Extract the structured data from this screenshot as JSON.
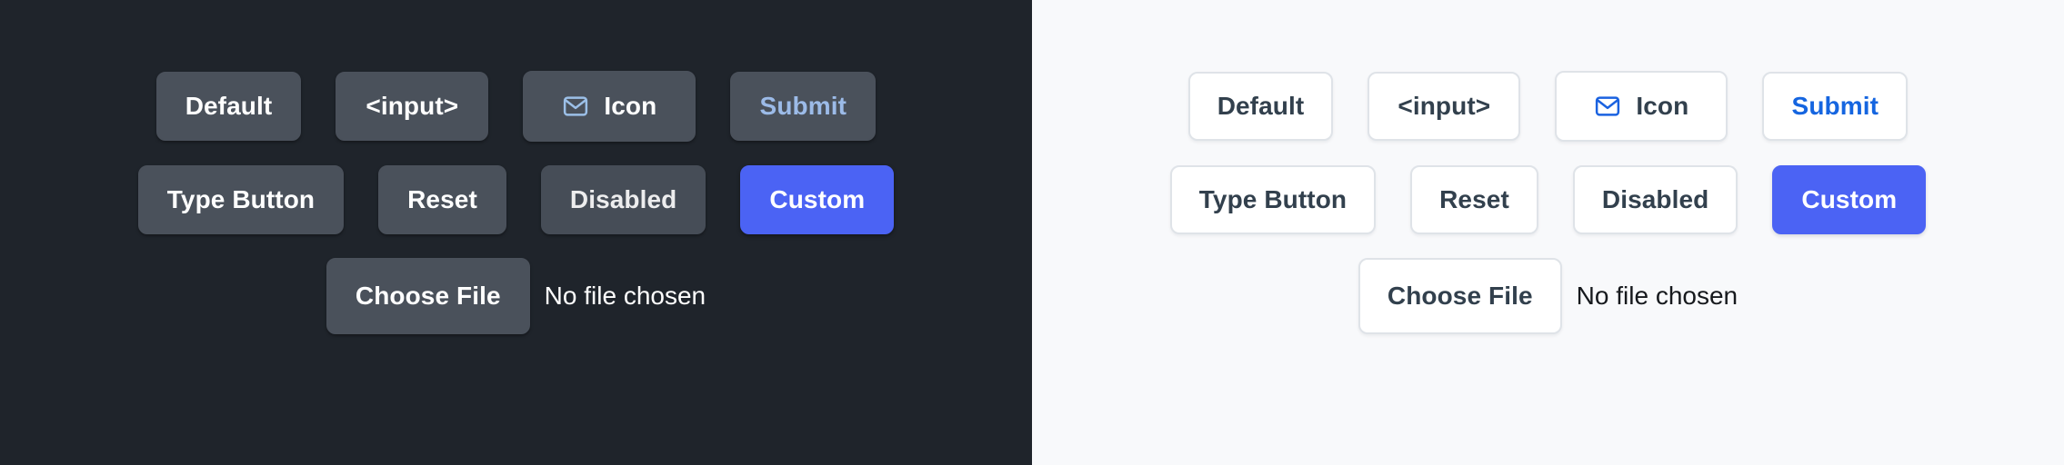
{
  "panels": [
    {
      "theme": "dark",
      "background": "#1f242b",
      "button_background": "#4a515b",
      "text_color": "#ffffff",
      "accent_color": "#4b63f4",
      "link_color": "#9cbbe8",
      "icon_color": "#9cc0e8",
      "rows": [
        [
          {
            "label": "Default",
            "name": "default-button",
            "variant": "default",
            "icon": null
          },
          {
            "label": "<input>",
            "name": "input-button",
            "variant": "default",
            "icon": null
          },
          {
            "label": "Icon",
            "name": "icon-button",
            "variant": "default",
            "icon": "mail-icon"
          },
          {
            "label": "Submit",
            "name": "submit-button",
            "variant": "submit",
            "icon": null
          }
        ],
        [
          {
            "label": "Type Button",
            "name": "type-button",
            "variant": "default",
            "icon": null
          },
          {
            "label": "Reset",
            "name": "reset-button",
            "variant": "default",
            "icon": null
          },
          {
            "label": "Disabled",
            "name": "disabled-button",
            "variant": "disabled",
            "icon": null
          },
          {
            "label": "Custom",
            "name": "custom-button",
            "variant": "custom",
            "icon": null
          }
        ]
      ],
      "file_input": {
        "button_label": "Choose File",
        "status_text": "No file chosen"
      }
    },
    {
      "theme": "light",
      "background": "#f8f9fb",
      "button_background": "#ffffff",
      "border_color": "#dfe3e8",
      "text_color": "#32404d",
      "accent_color": "#4b63f4",
      "link_color": "#1565e0",
      "icon_color": "#1a62e0",
      "rows": [
        [
          {
            "label": "Default",
            "name": "default-button",
            "variant": "default",
            "icon": null
          },
          {
            "label": "<input>",
            "name": "input-button",
            "variant": "default",
            "icon": null
          },
          {
            "label": "Icon",
            "name": "icon-button",
            "variant": "default",
            "icon": "mail-icon"
          },
          {
            "label": "Submit",
            "name": "submit-button",
            "variant": "submit",
            "icon": null
          }
        ],
        [
          {
            "label": "Type Button",
            "name": "type-button",
            "variant": "default",
            "icon": null
          },
          {
            "label": "Reset",
            "name": "reset-button",
            "variant": "default",
            "icon": null
          },
          {
            "label": "Disabled",
            "name": "disabled-button",
            "variant": "disabled",
            "icon": null
          },
          {
            "label": "Custom",
            "name": "custom-button",
            "variant": "custom",
            "icon": null
          }
        ]
      ],
      "file_input": {
        "button_label": "Choose File",
        "status_text": "No file chosen"
      }
    }
  ]
}
